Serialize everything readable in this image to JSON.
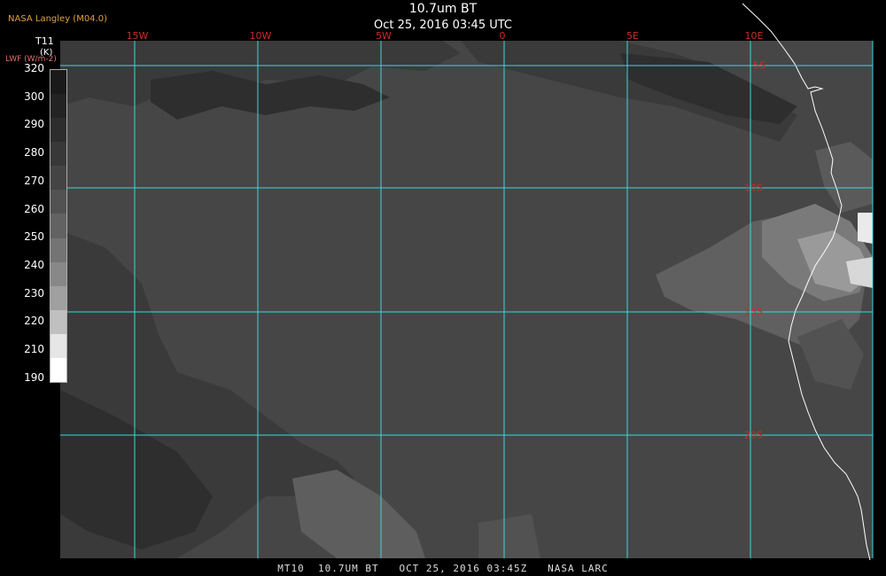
{
  "header": {
    "provider": "NASA Langley (M04.0)",
    "title": "10.7um BT",
    "subtitle": "Oct 25, 2016 03:45 UTC"
  },
  "footer": {
    "text": "MT10  10.7UM BT   OCT 25, 2016 03:45Z   NASA LARC"
  },
  "colorbar": {
    "title": "T11",
    "unit": "(K)",
    "alt_label": "LWF (W/m-2)",
    "ticks": [
      "320",
      "300",
      "290",
      "280",
      "270",
      "260",
      "250",
      "240",
      "230",
      "220",
      "210",
      "190"
    ],
    "shades": [
      "#1a1a1a",
      "#232323",
      "#2d2d2d",
      "#383838",
      "#444444",
      "#525252",
      "#626262",
      "#747474",
      "#888888",
      "#a0a0a0",
      "#c0c0c0",
      "#e6e6e6",
      "#ffffff"
    ]
  },
  "map": {
    "longitude_labels": [
      "15W",
      "10W",
      "5W",
      "0",
      "5E",
      "10E"
    ],
    "latitude_labels": [
      "5S",
      "10S",
      "15S",
      "20S"
    ],
    "grid_color": "#3fd6dc",
    "label_color": "#cc2b2b",
    "background_shade": "#464646"
  }
}
